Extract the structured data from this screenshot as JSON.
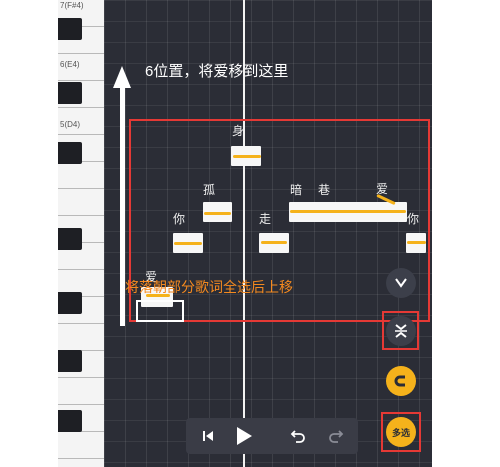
{
  "piano": {
    "labels": [
      "7(F#4)",
      "6(E4)",
      "5(D4)"
    ]
  },
  "lyrics": {
    "l1": "身",
    "l2": "孤",
    "l3": "你",
    "l4": "走",
    "l5": "暗",
    "l6": "巷",
    "l7": "爱",
    "l8": "你",
    "l9": "爱"
  },
  "annotations": {
    "top_note": "6位置，将爱移到这里",
    "bottom_note": "将落朝部分歌词全选后上移"
  },
  "tools": {
    "multi_select_label": "多选"
  },
  "colors": {
    "accent": "#f5b21b",
    "highlight": "#e53935",
    "editor_bg": "#2b2d36"
  },
  "icons": {
    "move": "move-icon",
    "expand": "expand-icon",
    "magnet": "magnet-icon",
    "prev": "skip-previous-icon",
    "play": "play-icon",
    "undo": "undo-icon",
    "redo": "redo-icon"
  }
}
